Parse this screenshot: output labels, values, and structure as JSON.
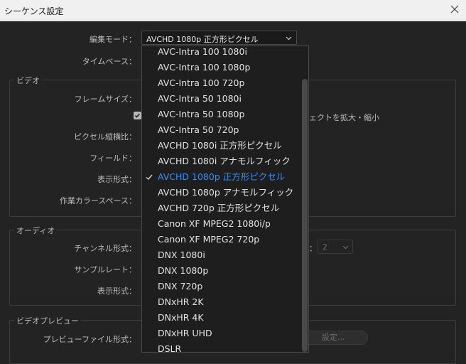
{
  "window": {
    "title": "シーケンス設定"
  },
  "editing_mode": {
    "label": "編集モード：",
    "value": "AVCHD  1080p 正方形ピクセル"
  },
  "timebase": {
    "label": "タイムベース："
  },
  "video": {
    "legend": "ビデオ",
    "frame_size_label": "フレームサイズ：",
    "scale_checkbox_text": "ェクトを拡大・縮小",
    "pixel_aspect_label": "ピクセル縦横比：",
    "fields_label": "フィールド：",
    "display_format_label": "表示形式：",
    "working_color_label": "作業カラースペース："
  },
  "audio": {
    "legend": "オーディオ",
    "channel_format_label": "チャンネル形式：",
    "channels_label": "：",
    "channels_value": "2",
    "sample_rate_label": "サンプルレート：",
    "display_format_label": "表示形式："
  },
  "video_preview": {
    "legend": "ビデオプレビュー",
    "preview_file_format_label": "プレビューファイル形式：",
    "settings_button": "設定..."
  },
  "dropdown": {
    "selected_index": 8,
    "items": [
      "AVC-Intra 100 1080i",
      "AVC-Intra 100 1080p",
      "AVC-Intra 100 720p",
      "AVC-Intra 50 1080i",
      "AVC-Intra 50 1080p",
      "AVC-Intra 50 720p",
      "AVCHD  1080i 正方形ピクセル",
      "AVCHD  1080i アナモルフィック",
      "AVCHD  1080p 正方形ピクセル",
      "AVCHD  1080p アナモルフィック",
      "AVCHD  720p 正方形ピクセル",
      "Canon XF MPEG2 1080i/p",
      "Canon XF MPEG2 720p",
      "DNX 1080i",
      "DNX 1080p",
      "DNX 720p",
      "DNxHR 2K",
      "DNxHR 4K",
      "DNxHR UHD",
      "DSLR"
    ]
  },
  "colors": {
    "selected": "#3c8cf0",
    "background": "#232323"
  }
}
